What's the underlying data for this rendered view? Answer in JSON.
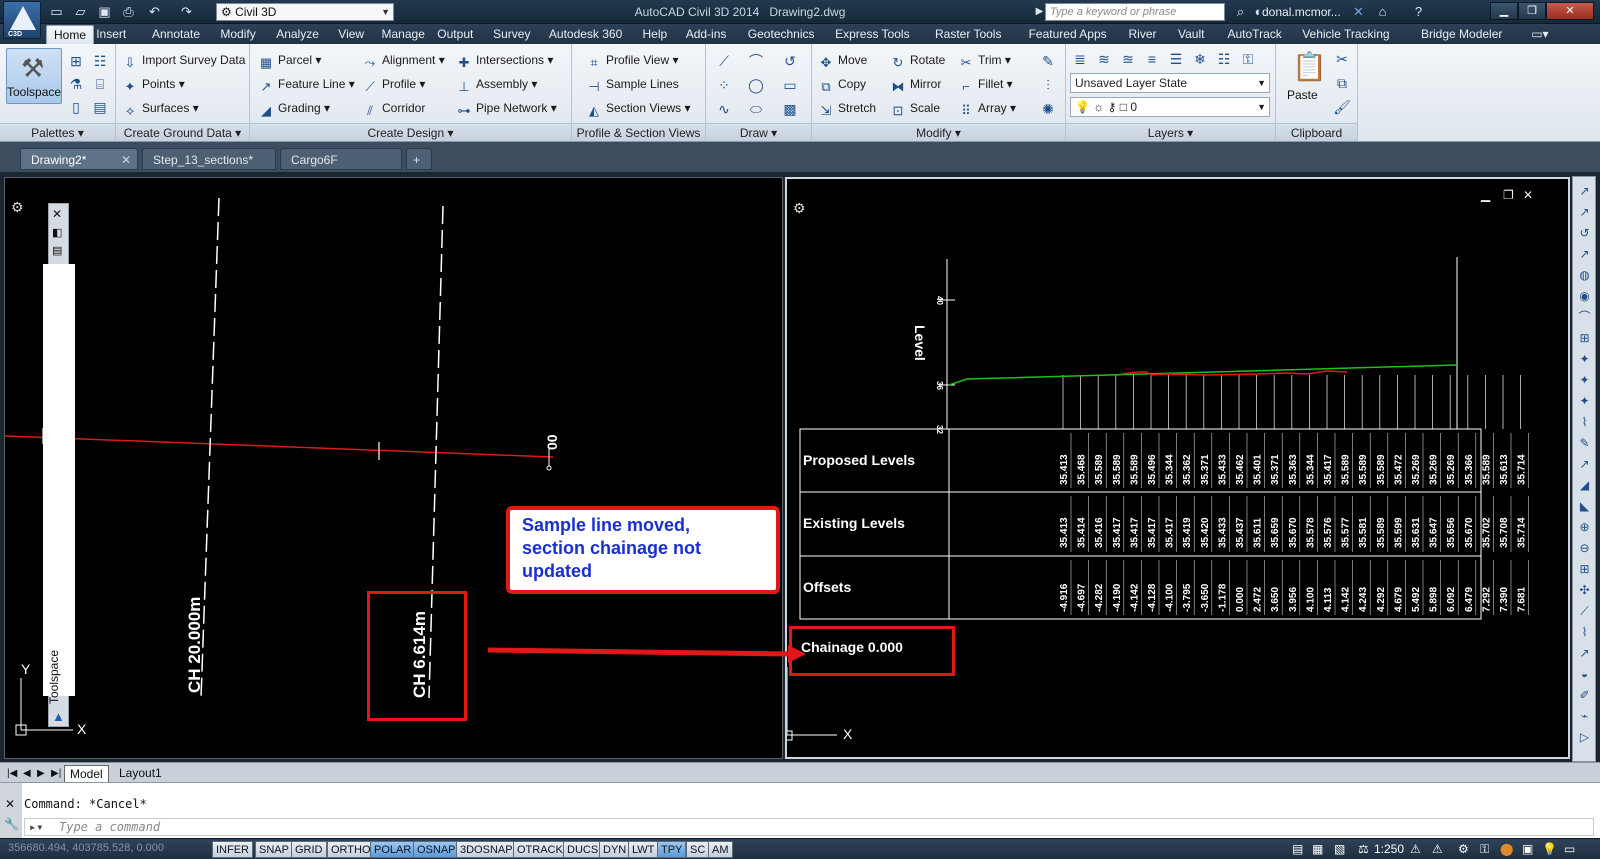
{
  "app": {
    "workspace": "Civil 3D",
    "title": "AutoCAD Civil 3D 2014",
    "drawing": "Drawing2.dwg",
    "search_placeholder": "Type a keyword or phrase",
    "user": "donal.mcmor...",
    "logo_caption": "C3D"
  },
  "ribbon_tabs": [
    "Home",
    "Insert",
    "Annotate",
    "Modify",
    "Analyze",
    "View",
    "Manage",
    "Output",
    "Survey",
    "Autodesk 360",
    "Help",
    "Add-ins",
    "Geotechnics",
    "Express Tools",
    "Raster Tools",
    "Featured Apps",
    "River",
    "Vault",
    "AutoTrack",
    "Vehicle Tracking",
    "Bridge Modeler"
  ],
  "panels": {
    "palettes": {
      "title": "Palettes",
      "toolspace": "Toolspace"
    },
    "ground": {
      "title": "Create Ground Data",
      "items": [
        "Import Survey Data",
        "Points",
        "Surfaces"
      ]
    },
    "design": {
      "title": "Create Design",
      "col1": [
        "Parcel",
        "Feature Line",
        "Grading"
      ],
      "col2": [
        "Alignment",
        "Profile",
        "Corridor"
      ],
      "col3": [
        "Intersections",
        "Assembly",
        "Pipe Network"
      ]
    },
    "profile": {
      "title": "Profile & Section Views",
      "items": [
        "Profile View",
        "Sample Lines",
        "Section Views"
      ]
    },
    "draw": {
      "title": "Draw"
    },
    "modify": {
      "title": "Modify",
      "col1": [
        "Move",
        "Copy",
        "Stretch"
      ],
      "col2": [
        "Rotate",
        "Mirror",
        "Scale"
      ],
      "col3": [
        "Trim",
        "Fillet",
        "Array"
      ]
    },
    "layers": {
      "title": "Layers",
      "layer_state": "Unsaved Layer State",
      "current_layer": "0"
    },
    "clipboard": {
      "title": "Clipboard",
      "paste": "Paste"
    }
  },
  "doc_tabs": [
    "Drawing2*",
    "Step_13_sections*",
    "Cargo6F"
  ],
  "left_view": {
    "palette_label": "Toolspace",
    "ch1": "CH 20.000m",
    "ch2": "CH 6.614m",
    "end_label": "00",
    "axis_y": "Y",
    "axis_x": "X"
  },
  "callout": {
    "line1": "Sample line moved,",
    "line2": "section chainage not",
    "line3": "updated"
  },
  "section": {
    "level_label": "Level",
    "axis_ticks": [
      "40",
      "36",
      "32"
    ],
    "row_labels": [
      "Proposed Levels",
      "Existing Levels",
      "Offsets"
    ],
    "proposed": [
      "35.413",
      "35.468",
      "35.589",
      "35.589",
      "35.589",
      "35.496",
      "35.344",
      "35.362",
      "35.371",
      "35.433",
      "35.462",
      "35.401",
      "35.371",
      "35.363",
      "35.344",
      "35.417",
      "35.589",
      "35.589",
      "35.589",
      "35.472",
      "35.269",
      "35.269",
      "35.269",
      "35.366",
      "35.589",
      "35.613",
      "35.714"
    ],
    "existing": [
      "35.413",
      "35.414",
      "35.416",
      "35.417",
      "35.417",
      "35.417",
      "35.417",
      "35.419",
      "35.420",
      "35.433",
      "35.437",
      "35.611",
      "35.659",
      "35.670",
      "35.578",
      "35.576",
      "35.577",
      "35.581",
      "35.589",
      "35.599",
      "35.631",
      "35.647",
      "35.656",
      "35.670",
      "35.702",
      "35.708",
      "35.714"
    ],
    "offsets": [
      "-4.916",
      "-4.697",
      "-4.282",
      "-4.190",
      "-4.142",
      "-4.128",
      "-4.100",
      "-3.795",
      "-3.650",
      "-1.178",
      "0.000",
      "2.472",
      "3.650",
      "3.956",
      "4.100",
      "4.113",
      "4.142",
      "4.243",
      "4.292",
      "4.679",
      "5.492",
      "5.898",
      "6.092",
      "6.479",
      "7.292",
      "7.390",
      "7.681"
    ],
    "chainage": "Chainage 0.000"
  },
  "bottom_tabs": [
    "Model",
    "Layout1"
  ],
  "command": {
    "history": "Command: *Cancel*",
    "placeholder": "Type a command"
  },
  "status": {
    "coords": "356680.494, 403785.528, 0.000",
    "toggles": [
      "INFER",
      "SNAP",
      "GRID",
      "ORTHO",
      "POLAR",
      "OSNAP",
      "3DOSNAP",
      "OTRACK",
      "DUCS",
      "DYN",
      "LWT",
      "TPY",
      "SC",
      "AM"
    ],
    "on_toggles": [
      "POLAR",
      "OSNAP",
      "TPY"
    ],
    "scale": "1:250"
  },
  "colors": {
    "callout": "#e01818",
    "callout_text": "#1a2fd0",
    "alignment": "#e01818",
    "existing_ground": "#19c419"
  }
}
